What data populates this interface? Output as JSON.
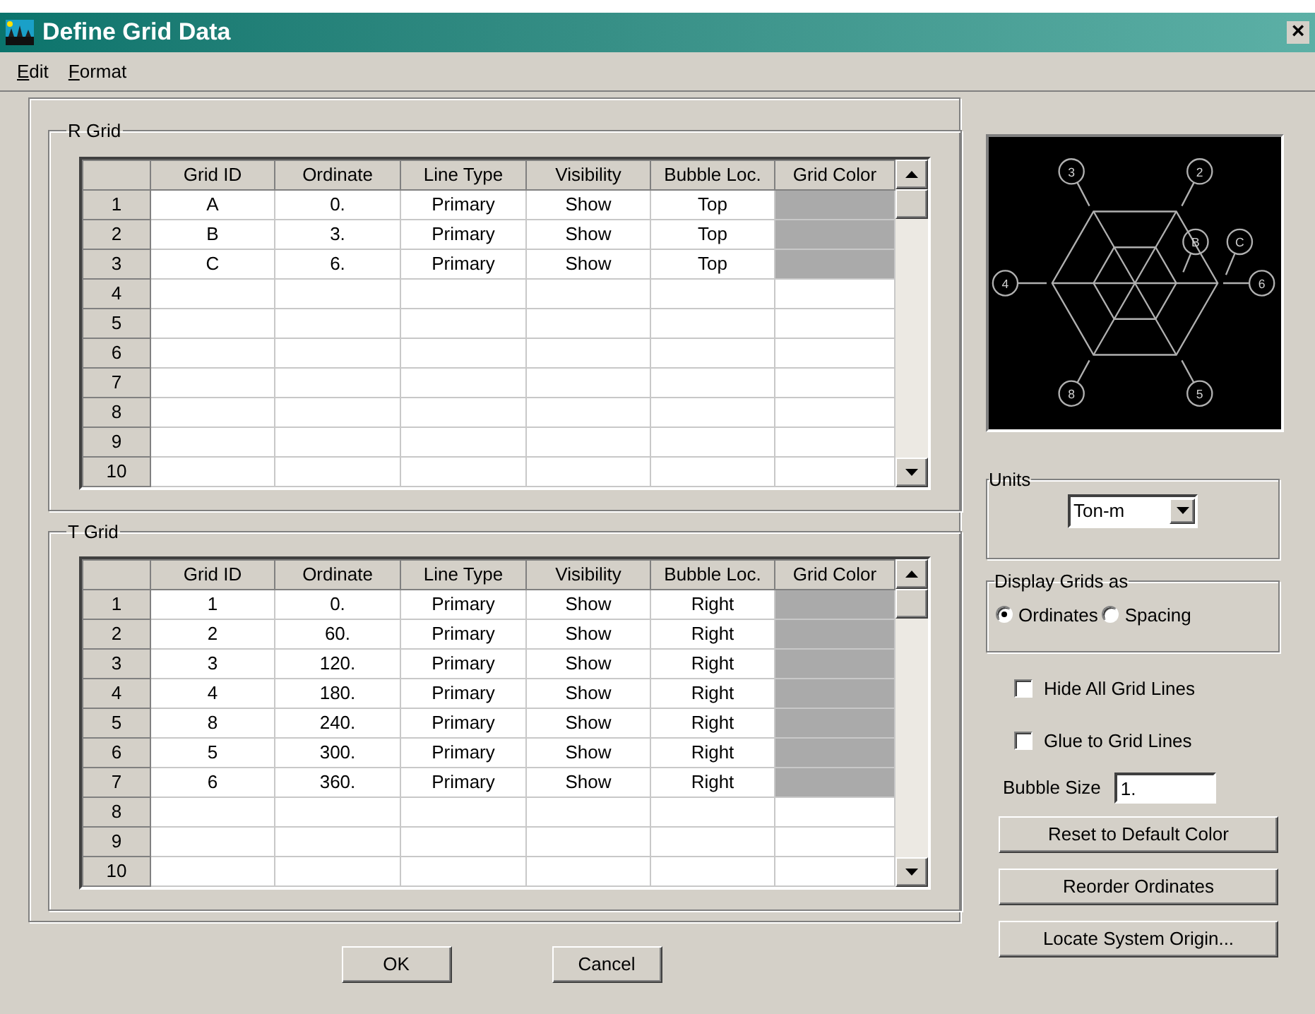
{
  "window": {
    "title": "Define Grid Data",
    "close": "×"
  },
  "menu": [
    "Edit",
    "Format"
  ],
  "grids": [
    {
      "title": "R Grid",
      "columns": [
        "Grid ID",
        "Ordinate",
        "Line Type",
        "Visibility",
        "Bubble Loc.",
        "Grid Color"
      ],
      "rows": [
        {
          "number": "1",
          "cells": [
            "A",
            "0.",
            "Primary",
            "Show",
            "Top"
          ],
          "color": "#aaaaaa"
        },
        {
          "number": "2",
          "cells": [
            "B",
            "3.",
            "Primary",
            "Show",
            "Top"
          ],
          "color": "#aaaaaa"
        },
        {
          "number": "3",
          "cells": [
            "C",
            "6.",
            "Primary",
            "Show",
            "Top"
          ],
          "color": "#aaaaaa"
        },
        {
          "number": "4"
        },
        {
          "number": "5"
        },
        {
          "number": "6"
        },
        {
          "number": "7"
        },
        {
          "number": "8"
        },
        {
          "number": "9"
        },
        {
          "number": "10"
        }
      ]
    },
    {
      "title": "T Grid",
      "columns": [
        "Grid ID",
        "Ordinate",
        "Line Type",
        "Visibility",
        "Bubble Loc.",
        "Grid Color"
      ],
      "rows": [
        {
          "number": "1",
          "cells": [
            "1",
            "0.",
            "Primary",
            "Show",
            "Right"
          ],
          "color": "#aaaaaa"
        },
        {
          "number": "2",
          "cells": [
            "2",
            "60.",
            "Primary",
            "Show",
            "Right"
          ],
          "color": "#aaaaaa"
        },
        {
          "number": "3",
          "cells": [
            "3",
            "120.",
            "Primary",
            "Show",
            "Right"
          ],
          "color": "#aaaaaa"
        },
        {
          "number": "4",
          "cells": [
            "4",
            "180.",
            "Primary",
            "Show",
            "Right"
          ],
          "color": "#aaaaaa"
        },
        {
          "number": "5",
          "cells": [
            "8",
            "240.",
            "Primary",
            "Show",
            "Right"
          ],
          "color": "#aaaaaa"
        },
        {
          "number": "6",
          "cells": [
            "5",
            "300.",
            "Primary",
            "Show",
            "Right"
          ],
          "color": "#aaaaaa"
        },
        {
          "number": "7",
          "cells": [
            "6",
            "360.",
            "Primary",
            "Show",
            "Right"
          ],
          "color": "#aaaaaa"
        },
        {
          "number": "8"
        },
        {
          "number": "9"
        },
        {
          "number": "10"
        }
      ]
    }
  ],
  "plan_view": {
    "bubbles": [
      "3",
      "2",
      "B",
      "C",
      "4",
      "6",
      "8",
      "5"
    ]
  },
  "units": {
    "title": "Units",
    "value": "Ton-m"
  },
  "display_grids": {
    "title": "Display Grids as",
    "options": [
      {
        "label": "Ordinates",
        "selected": true
      },
      {
        "label": "Spacing",
        "selected": false
      }
    ]
  },
  "checkboxes": [
    {
      "label": "Hide All Grid Lines",
      "checked": false
    },
    {
      "label": "Glue to Grid Lines",
      "checked": false
    }
  ],
  "bubble_size": {
    "label": "Bubble Size",
    "value": "1."
  },
  "side_buttons": [
    "Reset to Default Color",
    "Reorder Ordinates",
    "Locate System Origin..."
  ],
  "buttons": [
    "OK",
    "Cancel"
  ]
}
